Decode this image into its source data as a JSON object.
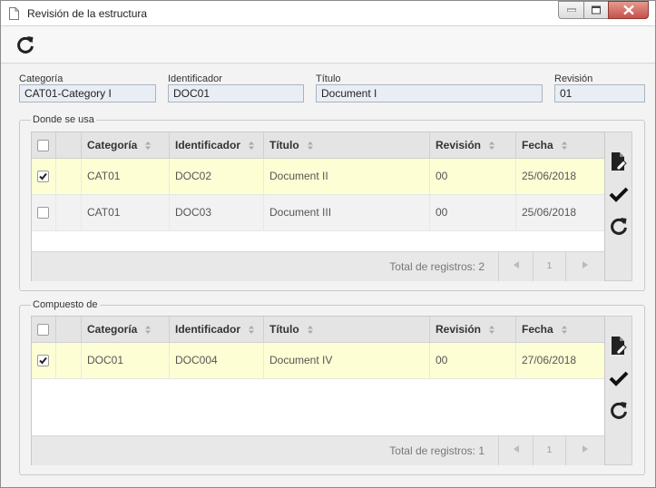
{
  "window": {
    "title": "Revisión de la estructura"
  },
  "toolbar": {
    "refresh_icon": "refresh-icon"
  },
  "header_fields": {
    "categoria": {
      "label": "Categoría",
      "value": "CAT01-Category I"
    },
    "identificador": {
      "label": "Identificador",
      "value": "DOC01"
    },
    "titulo": {
      "label": "Título",
      "value": "Document I"
    },
    "revision": {
      "label": "Revisión",
      "value": "01"
    }
  },
  "donde_se_usa": {
    "legend": "Donde se usa",
    "columns": [
      "Categoría",
      "Identificador",
      "Título",
      "Revisión",
      "Fecha"
    ],
    "rows": [
      {
        "checked": true,
        "categoria": "CAT01",
        "identificador": "DOC02",
        "titulo": "Document II",
        "revision": "00",
        "fecha": "25/06/2018"
      },
      {
        "checked": false,
        "categoria": "CAT01",
        "identificador": "DOC03",
        "titulo": "Document III",
        "revision": "00",
        "fecha": "25/06/2018"
      }
    ],
    "total_label": "Total de registros: 2",
    "page": "1"
  },
  "compuesto_de": {
    "legend": "Compuesto de",
    "columns": [
      "Categoría",
      "Identificador",
      "Título",
      "Revisión",
      "Fecha"
    ],
    "rows": [
      {
        "checked": true,
        "categoria": "DOC01",
        "identificador": "DOC004",
        "titulo": "Document IV",
        "revision": "00",
        "fecha": "27/06/2018"
      }
    ],
    "total_label": "Total de registros: 1",
    "page": "1"
  },
  "colors": {
    "selected_row": "#fefed5",
    "header_bg": "#e4e4e4",
    "input_bg": "#e9eef4"
  }
}
